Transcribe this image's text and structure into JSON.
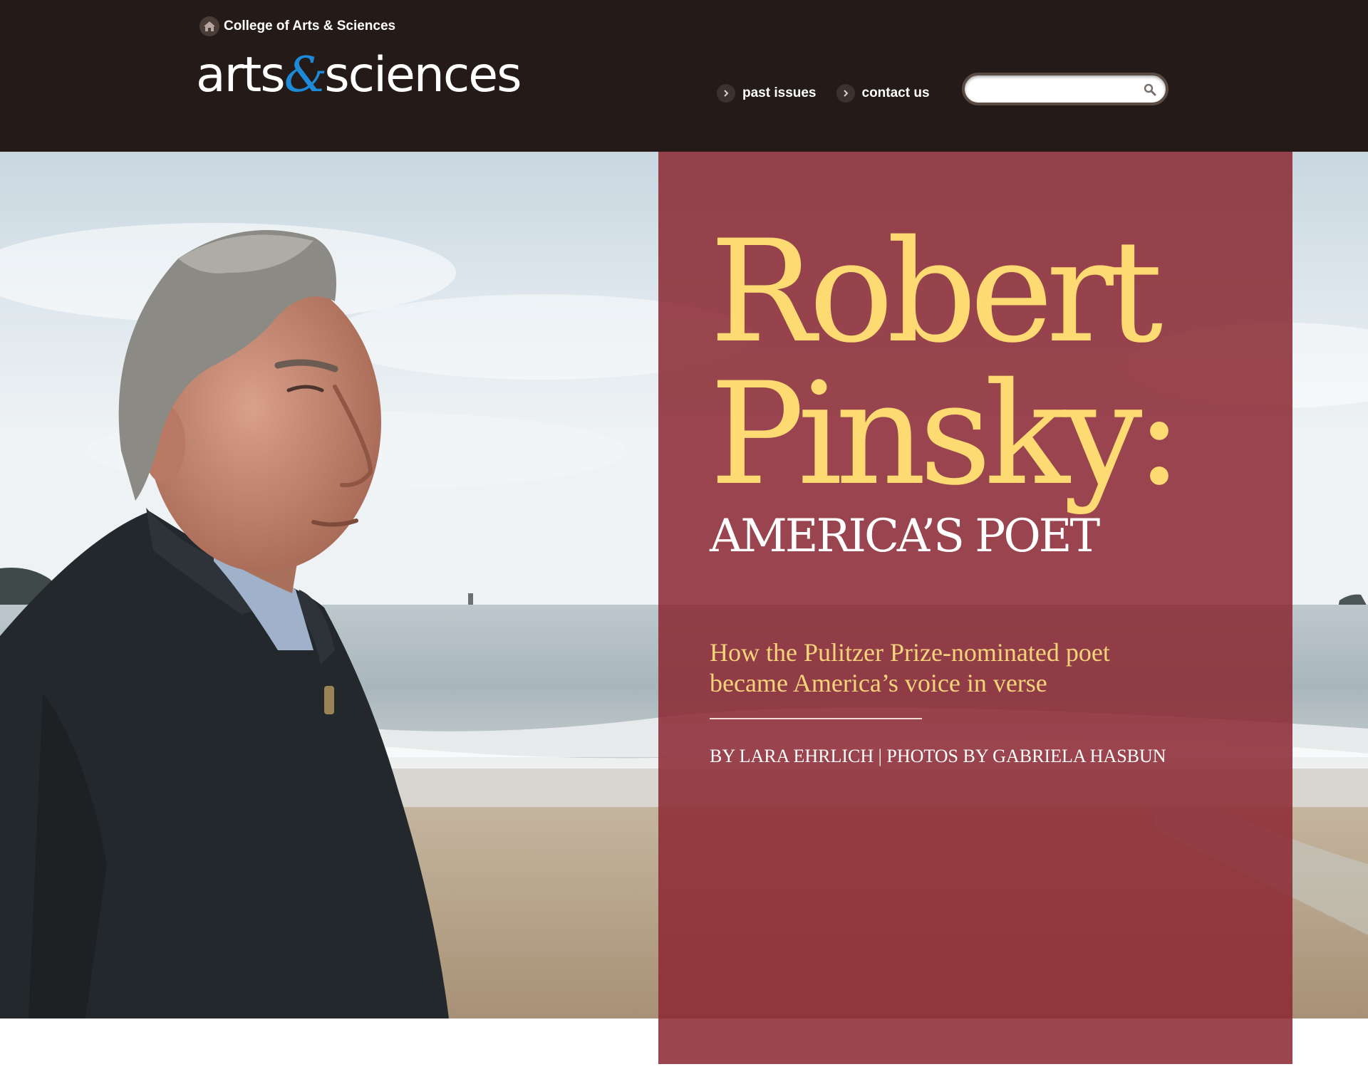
{
  "header": {
    "college_link": "College of Arts & Sciences",
    "logo": {
      "part1": "arts",
      "amp": "&",
      "part2": "sciences"
    },
    "nav": {
      "past_issues": "past issues",
      "contact_us": "contact us"
    },
    "search": {
      "placeholder": "",
      "value": ""
    },
    "icons": {
      "home": "home-icon",
      "nav_chevron": "chevron-right-icon",
      "search": "search-icon"
    }
  },
  "hero": {
    "photo_subject": "man-on-beach-photo"
  },
  "article": {
    "title_line1": "Robert",
    "title_line2": "Pinsky:",
    "subtitle": "AMERICA’S POET",
    "deck": "How the Pulitzer Prize-nominated poet became America’s voice in verse",
    "byline": "BY LARA EHRLICH | PHOTOS BY GABRIELA HASBUN"
  },
  "colors": {
    "header_bg": "#241a17",
    "logo_amp": "#1c8ad6",
    "panel_bg": "#8a2832",
    "title": "#fddb72",
    "deck": "#f7d47a"
  }
}
